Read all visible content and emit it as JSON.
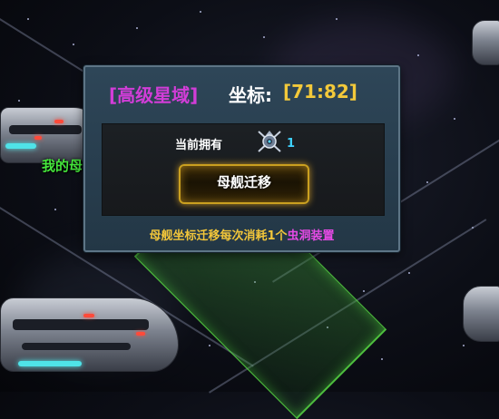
{
  "dialog": {
    "zone_name": "[高级星域]",
    "coord_label": "坐标:",
    "coord_value": "[71:82]",
    "owned_label": "当前拥有",
    "owned_icon": "wormhole-device-icon",
    "owned_count": "1",
    "migrate_button": "母舰迁移",
    "note_main": "母舰坐标迁移每次消耗1个",
    "note_item": "虫洞装置"
  },
  "map": {
    "ship_label": "我的母"
  },
  "colors": {
    "zone_name": "#d23dd8",
    "coord_value": "#f3c93a",
    "owned_count": "#3fd2ff",
    "note_main": "#f2c63a",
    "note_item": "#e64ae6",
    "ship_label": "#45e63c",
    "selected_tile": "#5adc46"
  }
}
